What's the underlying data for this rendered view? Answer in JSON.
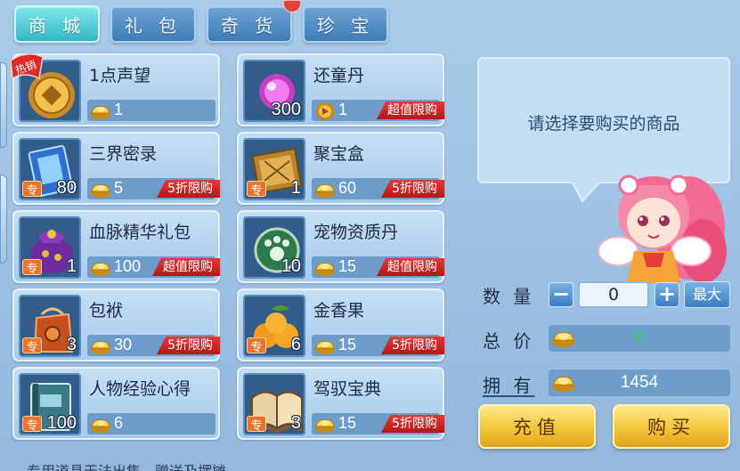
{
  "tabs": [
    {
      "label": "商 城",
      "active": true
    },
    {
      "label": "礼 包",
      "active": false
    },
    {
      "label": "奇 货",
      "active": false
    },
    {
      "label": "珍 宝",
      "active": false
    }
  ],
  "hot_badge": "热销",
  "currency_icon": "gold-ingot-icon",
  "items": [
    {
      "name": "1点声望",
      "price": "1",
      "qty": "",
      "exclusive": false,
      "hot": true,
      "promo": "",
      "icon": "reputation-coin-icon",
      "price_icon": "gold-ingot-icon"
    },
    {
      "name": "还童丹",
      "price": "1",
      "qty": "300",
      "exclusive": false,
      "hot": false,
      "promo": "超值限购",
      "icon": "purple-pill-icon",
      "price_icon": "coin-token-icon"
    },
    {
      "name": "三界密录",
      "price": "5",
      "qty": "80",
      "exclusive": true,
      "hot": false,
      "promo": "5折限购",
      "icon": "blue-book-icon",
      "price_icon": "gold-ingot-icon"
    },
    {
      "name": "聚宝盒",
      "price": "60",
      "qty": "1",
      "exclusive": true,
      "hot": false,
      "promo": "5折限购",
      "icon": "treasure-box-icon",
      "price_icon": "gold-ingot-icon"
    },
    {
      "name": "血脉精华礼包",
      "price": "100",
      "qty": "1",
      "exclusive": true,
      "hot": false,
      "promo": "超值限购",
      "icon": "purple-gift-bag-icon",
      "price_icon": "gold-ingot-icon"
    },
    {
      "name": "宠物资质丹",
      "price": "15",
      "qty": "10",
      "exclusive": false,
      "hot": false,
      "promo": "超值限购",
      "icon": "green-paw-orb-icon",
      "price_icon": "gold-ingot-icon"
    },
    {
      "name": "包袱",
      "price": "30",
      "qty": "3",
      "exclusive": true,
      "hot": false,
      "promo": "5折限购",
      "icon": "orange-pouch-icon",
      "price_icon": "gold-ingot-icon"
    },
    {
      "name": "金香果",
      "price": "15",
      "qty": "6",
      "exclusive": true,
      "hot": false,
      "promo": "5折限购",
      "icon": "golden-fruit-icon",
      "price_icon": "gold-ingot-icon"
    },
    {
      "name": "人物经验心得",
      "price": "6",
      "qty": "100",
      "exclusive": true,
      "hot": false,
      "promo": "",
      "icon": "teal-book-icon",
      "price_icon": "gold-ingot-icon"
    },
    {
      "name": "驾驭宝典",
      "price": "15",
      "qty": "3",
      "exclusive": true,
      "hot": false,
      "promo": "5折限购",
      "icon": "open-book-icon",
      "price_icon": "gold-ingot-icon"
    }
  ],
  "exclusive_label": "专",
  "panel": {
    "prompt": "请选择要购买的商品",
    "quantity_label": "数 量",
    "quantity_value": "0",
    "minus": "−",
    "plus": "+",
    "max_label": "最大",
    "total_label": "总 价",
    "total_value": "0",
    "owned_label": "拥 有",
    "owned_value": "1454",
    "recharge_label": "充值",
    "buy_label": "购买"
  },
  "footer_note": "专用道具无法出售、赠送及摆摊",
  "colors": {
    "promo_red": "#d22a2a",
    "total_green": "#22e04a",
    "tab_active": "#33b7c6",
    "tab_inactive": "#3f7cb8"
  }
}
